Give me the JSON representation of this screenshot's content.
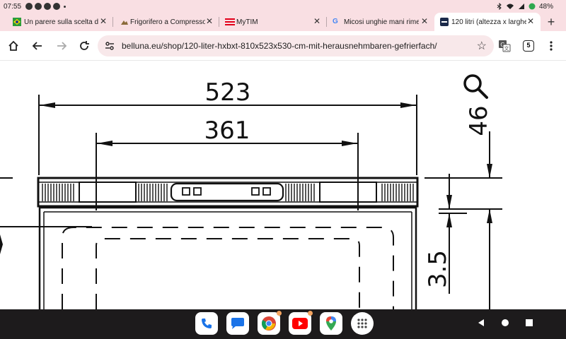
{
  "status_bar": {
    "time": "07:55",
    "battery": "48%"
  },
  "tabs": [
    {
      "title": "Un parere sulla scelta de",
      "favicon": "flag-icon",
      "active": false
    },
    {
      "title": "Frigorifero a Compresso",
      "favicon": "mountain-icon",
      "active": false
    },
    {
      "title": "MyTIM",
      "favicon": "tim-icon",
      "active": false
    },
    {
      "title": "Micosi unghie mani rime",
      "favicon": "google-icon",
      "active": false
    },
    {
      "title": "120 litri (altezza x larghe",
      "favicon": "belluna-icon",
      "active": true
    }
  ],
  "toolbar": {
    "url": "belluna.eu/shop/120-liter-hxbxt-810x523x530-cm-mit-herausnehmbaren-gefrierfach/",
    "tab_count": "5"
  },
  "drawing": {
    "dim_width_outer": "523",
    "dim_width_inner": "361",
    "dim_top": "46",
    "dim_side": "3.5"
  },
  "colors": {
    "chrome_bg": "#f9dfe3",
    "omnibox_bg": "#f8e8ea",
    "nav_bar_bg": "#1d1b1c",
    "line_color": "#111111"
  }
}
